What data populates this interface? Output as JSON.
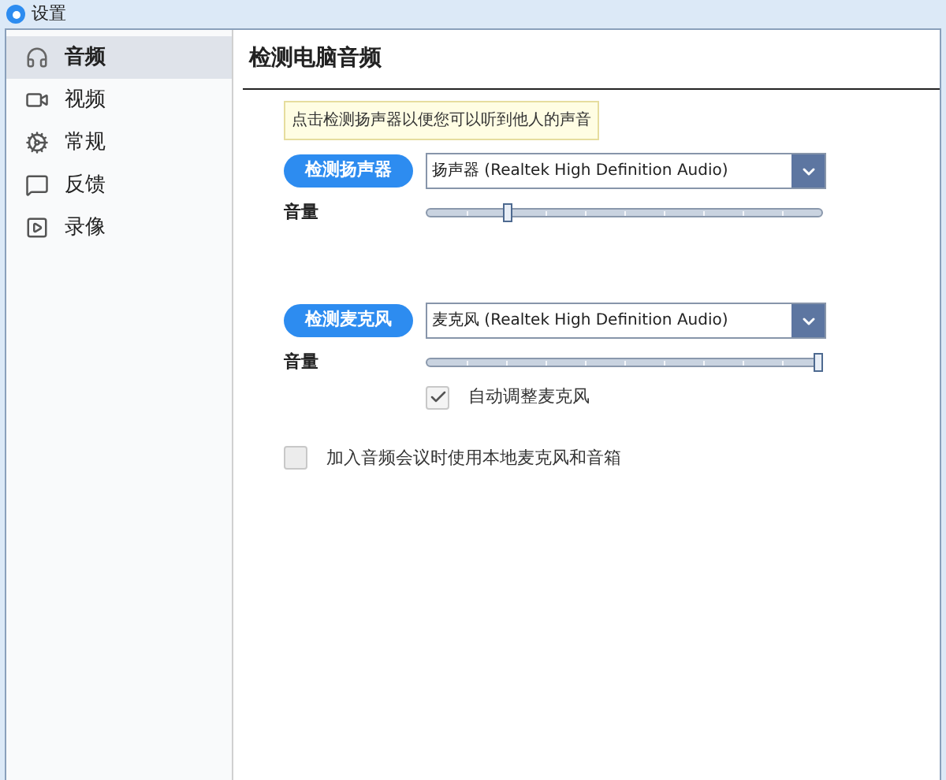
{
  "window": {
    "title": "设置"
  },
  "sidebar": {
    "items": [
      {
        "label": "音频",
        "selected": true
      },
      {
        "label": "视频",
        "selected": false
      },
      {
        "label": "常规",
        "selected": false
      },
      {
        "label": "反馈",
        "selected": false
      },
      {
        "label": "录像",
        "selected": false
      }
    ]
  },
  "content": {
    "heading": "检测电脑音频",
    "tooltip": "点击检测扬声器以便您可以听到他人的声音",
    "devices": [
      {
        "button": "检测扬声器",
        "device": "扬声器 (Realtek High Definition Audio)",
        "volume_label": "音量",
        "level": 0.2
      },
      {
        "button": "检测麦克风",
        "device": "麦克风 (Realtek High Definition Audio)",
        "volume_label": "音量",
        "level": 1.0,
        "auto_adjust": {
          "label": "自动调整麦克风",
          "checked": true
        }
      }
    ],
    "join_option": {
      "label": "加入音频会议时使用本地麦克风和音箱",
      "checked": false
    }
  }
}
